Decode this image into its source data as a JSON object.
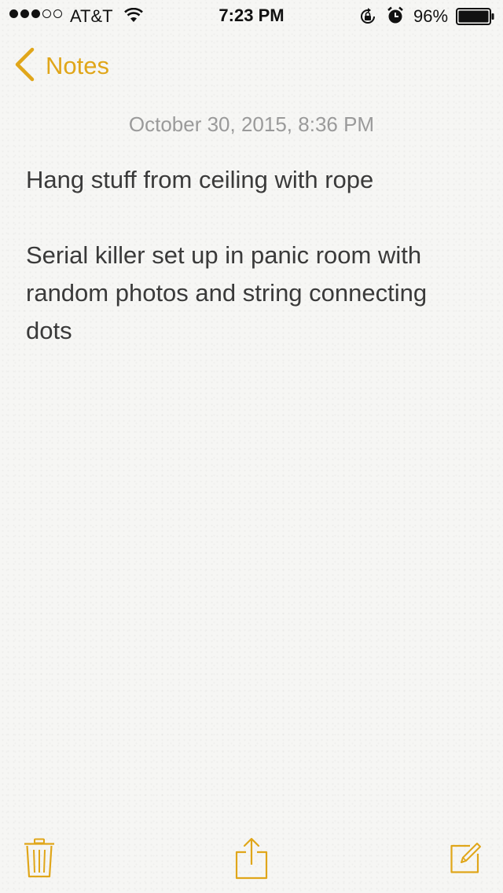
{
  "status_bar": {
    "signal_bars_filled": 3,
    "signal_bars_total": 5,
    "carrier": "AT&T",
    "time": "7:23 PM",
    "battery_percent": "96%",
    "icons": [
      "signal-icon",
      "wifi-icon",
      "rotation-lock-icon",
      "alarm-icon",
      "battery-icon"
    ]
  },
  "nav": {
    "back_label": "Notes"
  },
  "note": {
    "date": "October 30, 2015, 8:36 PM",
    "paragraphs": [
      [
        "Hang stuff from ceiling with rope"
      ],
      [
        "Serial killer set up in panic room with",
        "random photos and string connecting",
        "dots"
      ]
    ]
  },
  "toolbar": {
    "icons": [
      "trash-icon",
      "share-icon",
      "compose-icon"
    ]
  },
  "colors": {
    "accent": "#e0a61a",
    "paper": "#f6f6f4",
    "body_text": "#3a3a3a",
    "date_text": "#9a9a9a"
  }
}
